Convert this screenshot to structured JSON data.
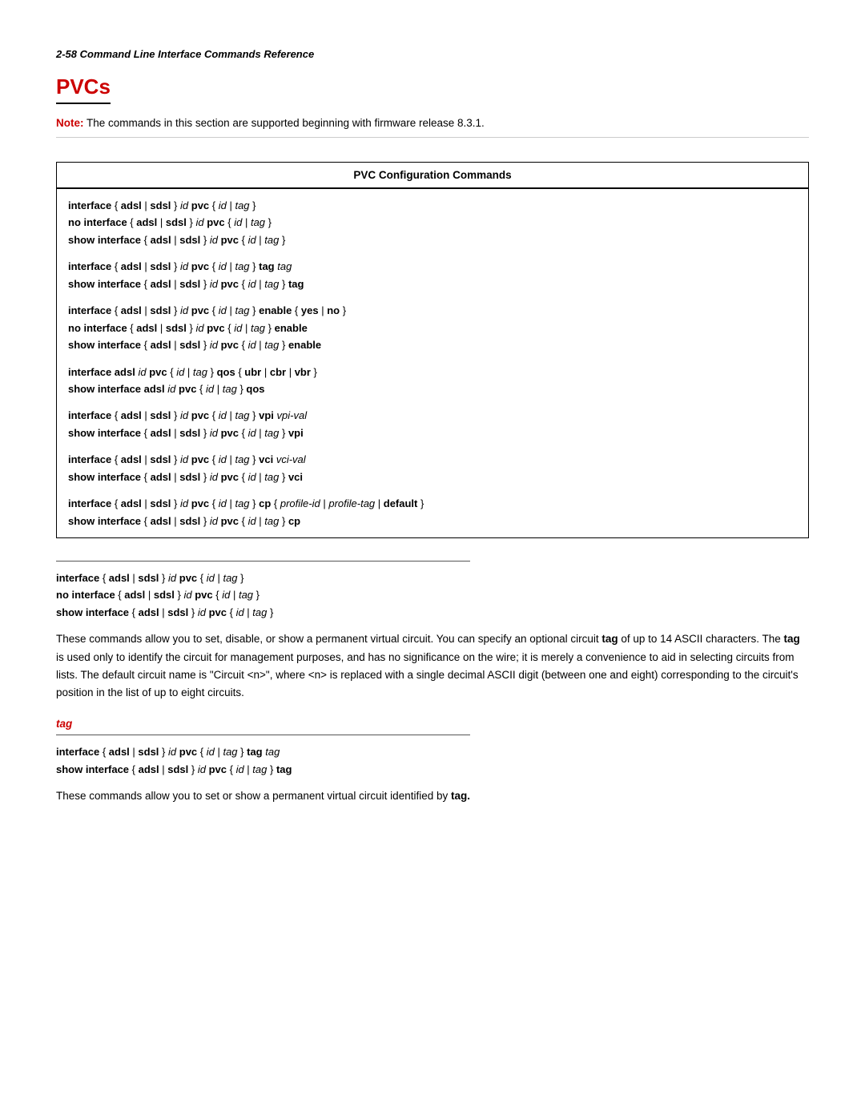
{
  "header": {
    "text": "2-58  Command Line Interface Commands Reference"
  },
  "section": {
    "title": "PVCs"
  },
  "note": {
    "label": "Note:",
    "text": "The commands in this section are supported beginning with firmware release 8.3.1."
  },
  "table": {
    "header": "PVC Configuration Commands",
    "groups": [
      {
        "lines": [
          {
            "prefix_bold": "interface",
            "rest": " { adsl | sdsl } id pvc { id | tag }"
          },
          {
            "prefix_bold": "no interface",
            "rest": " { adsl | sdsl } id pvc { id | tag }"
          },
          {
            "prefix_bold": "show interface",
            "rest": " { adsl | sdsl } id pvc { id | tag }"
          }
        ]
      },
      {
        "lines": [
          {
            "prefix_bold": "interface",
            "rest": " { adsl | sdsl } id pvc { id | tag } tag tag"
          },
          {
            "prefix_bold": "show interface",
            "rest": " { adsl | sdsl } id pvc { id | tag } tag"
          }
        ]
      },
      {
        "lines": [
          {
            "prefix_bold": "interface",
            "rest": " { adsl | sdsl } id pvc { id | tag } enable { yes | no }"
          },
          {
            "prefix_bold": "no interface",
            "rest": " { adsl | sdsl } id pvc { id | tag } enable"
          },
          {
            "prefix_bold": "show interface",
            "rest": " { adsl | sdsl } id pvc { id | tag } enable"
          }
        ]
      },
      {
        "lines": [
          {
            "prefix_bold": "interface adsl",
            "rest": " id pvc { id | tag } qos { ubr | cbr | vbr }"
          },
          {
            "prefix_bold": "show interface adsl",
            "rest": " id pvc { id | tag } qos"
          }
        ]
      },
      {
        "lines": [
          {
            "prefix_bold": "interface",
            "rest": " { adsl | sdsl } id pvc { id | tag } vpi vpi-val"
          },
          {
            "prefix_bold": "show interface",
            "rest": " { adsl | sdsl } id pvc { id | tag } vpi"
          }
        ]
      },
      {
        "lines": [
          {
            "prefix_bold": "interface",
            "rest": " { adsl | sdsl } id pvc { id | tag } vci vci-val"
          },
          {
            "prefix_bold": "show interface",
            "rest": " { adsl | sdsl } id pvc { id | tag } vci"
          }
        ]
      },
      {
        "lines": [
          {
            "prefix_bold": "interface",
            "rest": " { adsl | sdsl } id pvc { id | tag } cp { profile-id | profile-tag | default }"
          },
          {
            "prefix_bold": "show interface",
            "rest": " { adsl | sdsl } id pvc { id | tag } cp"
          }
        ]
      }
    ]
  },
  "cmd_section1": {
    "lines": [
      {
        "prefix_bold": "interface",
        "rest": " { adsl | sdsl } id pvc { id | tag }"
      },
      {
        "prefix_bold": "no interface",
        "rest": " { adsl | sdsl } id pvc { id | tag }"
      },
      {
        "prefix_bold": "show interface",
        "rest": " { adsl | sdsl } id pvc { id | tag }"
      }
    ],
    "description": "These commands allow you to set, disable, or show a permanent virtual circuit. You can specify an optional circuit tag of up to 14 ASCII characters. The tag is used only to identify the circuit for management purposes, and has no significance on the wire; it is merely a convenience to aid in selecting circuits from lists. The default circuit name is \"Circuit <n>\", where <n> is replaced with a single decimal ASCII digit (between one and eight) corresponding to the circuit’s position in the list of up to eight circuits."
  },
  "cmd_section2": {
    "subsection": "tag",
    "lines": [
      {
        "prefix_bold": "interface",
        "rest": " { adsl | sdsl } id pvc { id | tag } tag tag"
      },
      {
        "prefix_bold": "show interface",
        "rest": " { adsl | sdsl } id pvc { id | tag } tag"
      }
    ],
    "description": "These commands allow you to set or show a permanent virtual circuit identified by tag."
  }
}
